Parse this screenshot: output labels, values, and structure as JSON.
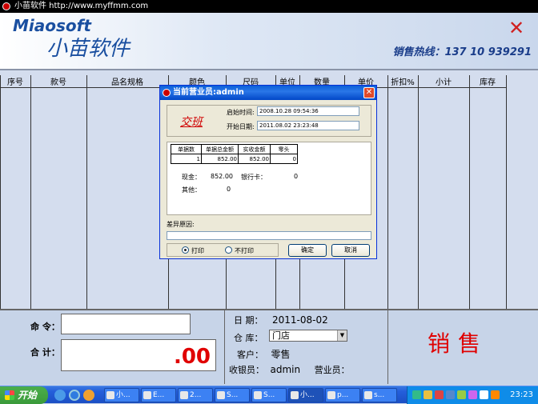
{
  "window": {
    "title": "小苗软件 http://www.myffmm.com"
  },
  "banner": {
    "logo_en": "Miaosoft",
    "logo_cn": "小苗软件",
    "hotline": "销售热线：137 10 939291"
  },
  "grid": {
    "columns": [
      "序号",
      "款号",
      "品名规格",
      "颜色",
      "尺码",
      "单位",
      "数量",
      "单价",
      "折扣%",
      "小计",
      "库存"
    ]
  },
  "bottom": {
    "command_label": "命 令：",
    "total_label": "合 计：",
    "total_value": ".00",
    "date_label": "日 期：",
    "date_value": "2011-08-02",
    "store_label": "仓 库：",
    "store_value": "门店",
    "customer_label": "客户：",
    "customer_value": "零售",
    "cashier_label": "收银员：",
    "cashier_value": "admin",
    "sales_label": "营业员：",
    "mode": "销售"
  },
  "dialog": {
    "title": "当前营业员:admin",
    "heading": "交班",
    "start_time_label": "启始时间:",
    "start_time_value": "2008.10.28 09:54:36",
    "start_date_label": "开始日期:",
    "start_date_value": "2011.08.02 23:23:48",
    "table": {
      "headers": [
        "单据数",
        "单据总金额",
        "实收金额",
        "零头"
      ],
      "row": [
        "1",
        "852.00",
        "852.00",
        "0"
      ]
    },
    "cash_label": "现金：",
    "cash_value": "852.00",
    "bank_label": "银行卡：",
    "bank_value": "0",
    "other_label": "其他：",
    "other_value": "0",
    "reason_label": "差异原因:",
    "print_label": "打印",
    "noprint_label": "不打印",
    "ok_label": "确定",
    "cancel_label": "取消"
  },
  "taskbar": {
    "start_label": "开始",
    "tasks": [
      "小...",
      "E...",
      "2...",
      "S...",
      "S...",
      "小...",
      "p...",
      "s..."
    ],
    "clock": "23:23"
  },
  "colors": {
    "accent": "#1a4fa0",
    "alert": "#e00000",
    "grid_bg": "#d4ddee",
    "taskbar": "#245edb"
  }
}
